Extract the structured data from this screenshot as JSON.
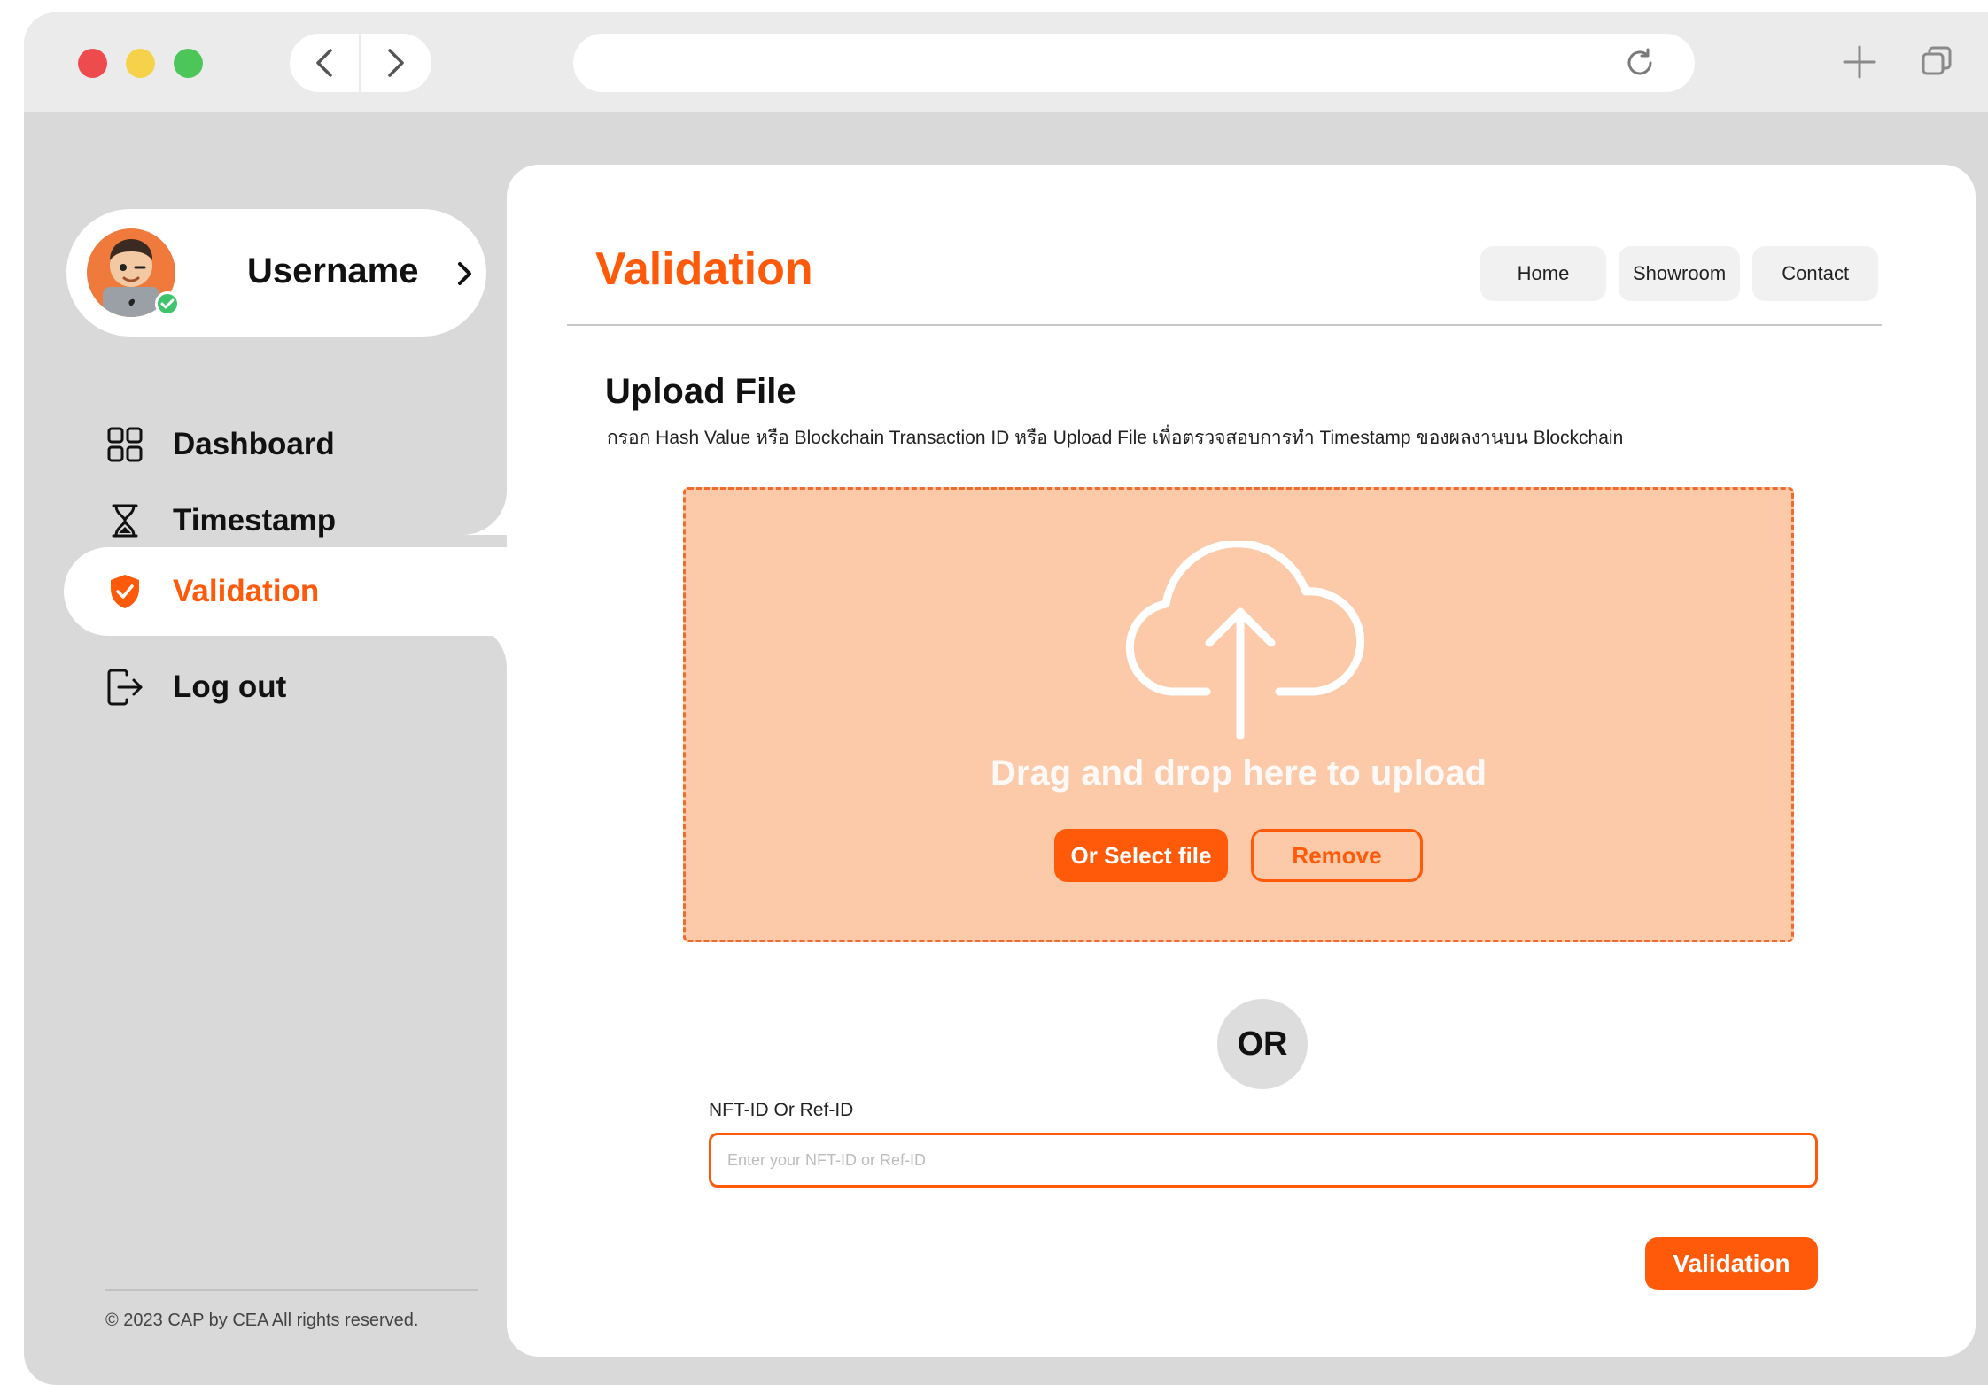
{
  "browser": {
    "address": "",
    "icons": {
      "back": "chevron-left-icon",
      "forward": "chevron-right-icon",
      "reload": "reload-icon",
      "new_tab": "plus-icon",
      "tabs": "tabs-icon"
    }
  },
  "sidebar": {
    "user": {
      "name": "Username"
    },
    "items": [
      {
        "label": "Dashboard",
        "icon": "grid-icon",
        "active": false
      },
      {
        "label": "Timestamp",
        "icon": "hourglass-icon",
        "active": false
      },
      {
        "label": "Validation",
        "icon": "shield-check-icon",
        "active": true
      },
      {
        "label": "Log out",
        "icon": "logout-icon",
        "active": false
      }
    ],
    "copyright": "© 2023  CAP by CEA All rights reserved."
  },
  "header": {
    "title": "Validation",
    "nav": [
      "Home",
      "Showroom",
      "Contact"
    ]
  },
  "upload": {
    "title": "Upload  File",
    "description": "กรอก Hash Value หรือ Blockchain Transaction ID หรือ Upload File เพื่อตรวจสอบการทำ Timestamp ของผลงานบน Blockchain",
    "drop_text": "Drag and drop here to upload",
    "select_label": "Or Select file",
    "remove_label": "Remove"
  },
  "divider": {
    "or_label": "OR"
  },
  "form": {
    "label": "NFT-ID Or Ref-ID",
    "placeholder": "Enter your NFT-ID or Ref-ID",
    "value": "",
    "submit_label": "Validation"
  },
  "colors": {
    "accent": "#ff5a0a",
    "dropzone_bg": "#fccaa9",
    "sidebar_bg": "#d9d9d9"
  }
}
